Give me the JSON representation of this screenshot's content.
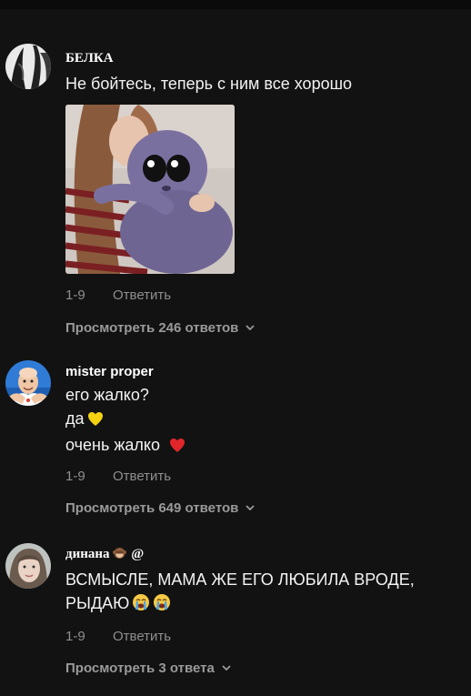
{
  "comments": [
    {
      "username": "БЕЛКА",
      "lines": [
        "Не бойтесь, теперь с ним все хорошо"
      ],
      "date": "1-9",
      "reply_label": "Ответить",
      "view_replies": "Просмотреть 246 ответов"
    },
    {
      "username": "mister proper",
      "lines": [
        "его жалко?",
        "да",
        "очень жалко"
      ],
      "date": "1-9",
      "reply_label": "Ответить",
      "view_replies": "Просмотреть 649 ответов"
    },
    {
      "username": "динана",
      "username_suffix": "@",
      "lines": [
        "ВСМЫСЛЕ, МАМА ЖЕ ЕГО ЛЮБИЛА ВРОДЕ,",
        "РЫДАЮ"
      ],
      "date": "1-9",
      "reply_label": "Ответить",
      "view_replies": "Просмотреть 3 ответа"
    }
  ],
  "icons": {
    "chevron": "chevron-down-icon",
    "yellow_heart": "yellow-heart-icon",
    "red_heart": "red-heart-icon",
    "crying_face": "loudly-crying-face-icon",
    "monkey": "see-no-evil-monkey-icon"
  },
  "colors": {
    "background": "#121212",
    "text": "#f3f3f3",
    "meta": "#8e8e8e",
    "yellow_heart": "#f5d211",
    "red_heart": "#e0262b"
  }
}
